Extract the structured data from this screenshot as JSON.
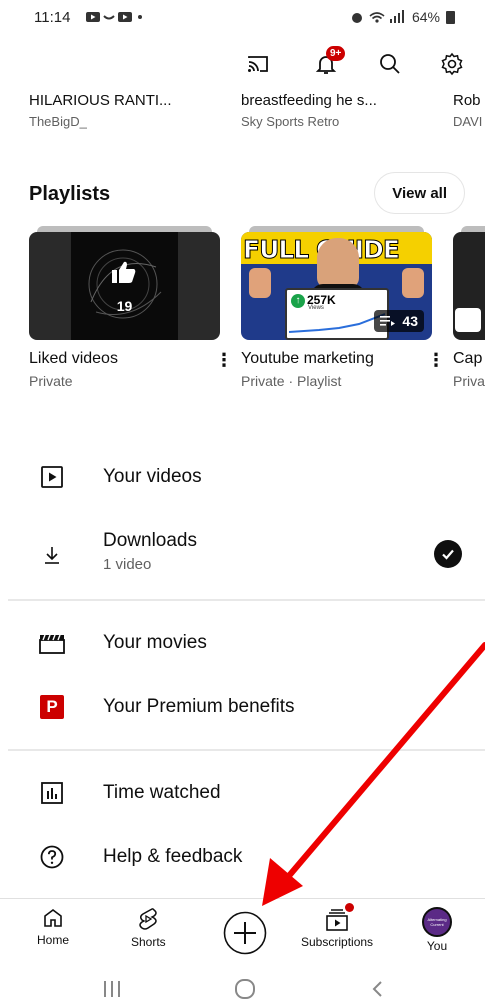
{
  "status_bar": {
    "time": "11:14",
    "battery": "64%"
  },
  "history": [
    {
      "title": "HILARIOUS RANTI...",
      "channel": "TheBigD_"
    },
    {
      "title": "breastfeeding he s...",
      "channel": "Sky Sports Retro"
    },
    {
      "title": "Rob",
      "channel": "DAVI"
    }
  ],
  "notifications": {
    "badge": "9+"
  },
  "playlists": {
    "title": "Playlists",
    "view_all": "View all",
    "items": [
      {
        "title": "Liked videos",
        "subtitle": "Private",
        "count": "19"
      },
      {
        "title": "Youtube marketing",
        "subtitle": "Private · Playlist",
        "count": "43",
        "thumb_text": "FULL GUIDE",
        "thumb_metric": "257K",
        "thumb_metric_sub": "Views"
      },
      {
        "title": "Cap",
        "subtitle": "Priva"
      }
    ]
  },
  "menu": {
    "your_videos": "Your videos",
    "downloads": "Downloads",
    "downloads_sub": "1 video",
    "your_movies": "Your movies",
    "premium": "Your Premium benefits",
    "premium_icon_letter": "P",
    "time_watched": "Time watched",
    "help": "Help & feedback"
  },
  "bottom_nav": {
    "home": "Home",
    "shorts": "Shorts",
    "subscriptions": "Subscriptions",
    "you": "You",
    "avatar_text": "Alternating Current"
  },
  "colors": {
    "brand_red": "#cc0000",
    "arrow_red": "#ee0000",
    "avatar_purple": "#5b2a86"
  }
}
